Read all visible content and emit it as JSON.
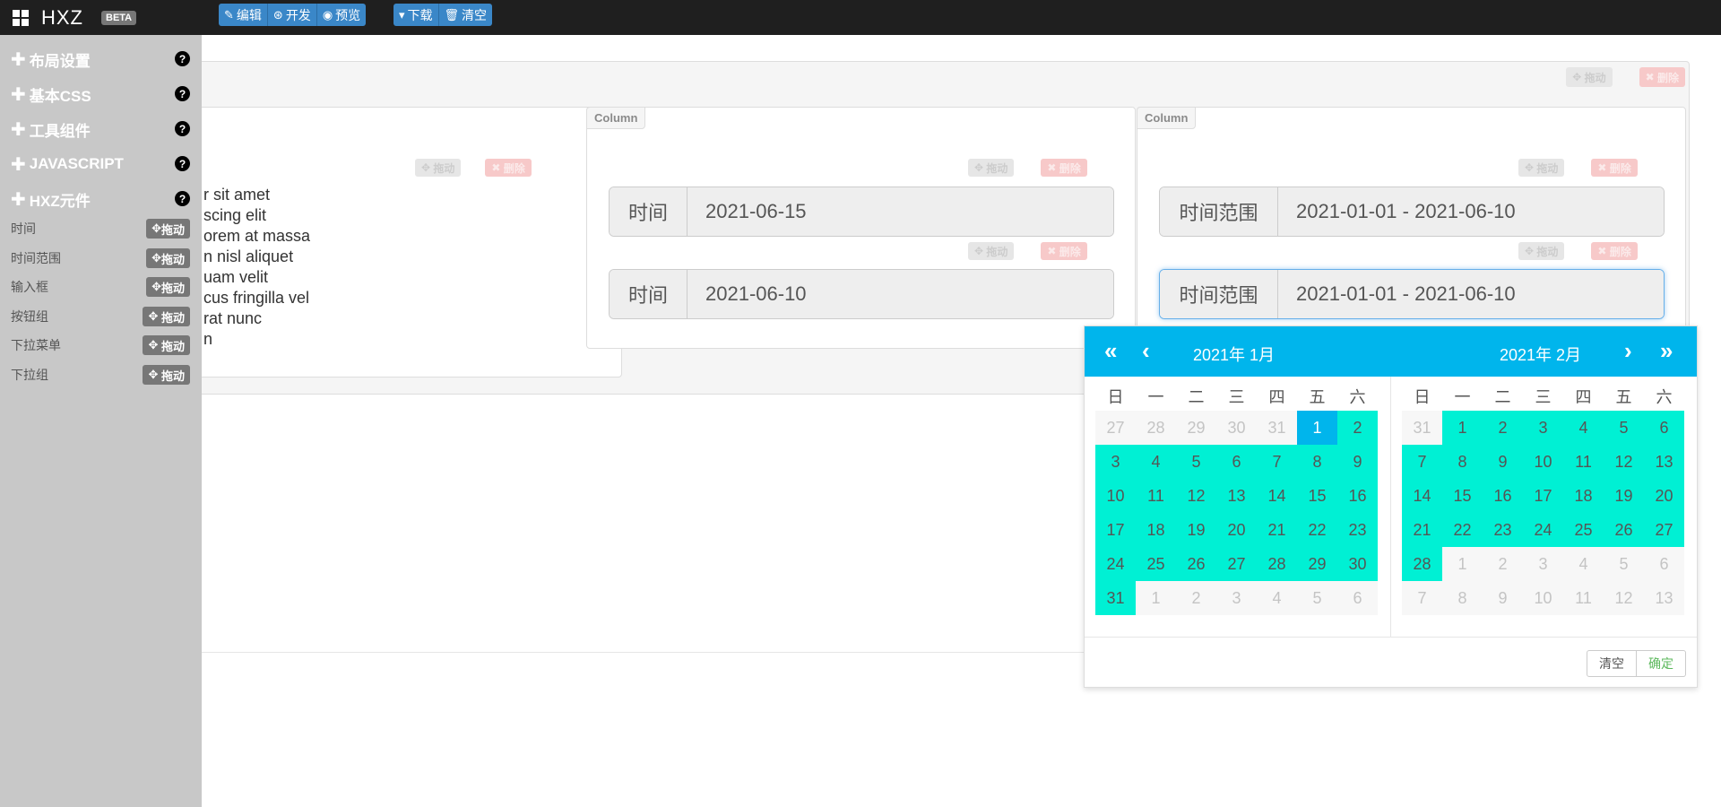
{
  "navbar": {
    "brand": "HXZ",
    "beta": "BETA",
    "group1": [
      {
        "label": "编辑",
        "icon": "edit-icon",
        "glyph": "✎"
      },
      {
        "label": "开发",
        "icon": "code-icon",
        "glyph": "⊛"
      },
      {
        "label": "预览",
        "icon": "eye-icon",
        "glyph": "◉"
      }
    ],
    "group2": [
      {
        "label": "下载",
        "icon": "chevron-down-icon",
        "glyph": "▾"
      },
      {
        "label": "清空",
        "icon": "trash-icon",
        "glyph": "🗑"
      }
    ]
  },
  "sidebar": {
    "sections": [
      "布局设置",
      "基本CSS",
      "工具组件",
      "JAVASCRIPT",
      "HXZ元件"
    ],
    "help_glyph": "?",
    "items": [
      "时间",
      "时间范围",
      "输入框",
      "按钮组",
      "下拉菜单",
      "下拉组"
    ],
    "drag_label": "拖动"
  },
  "layout": {
    "drag_label": "拖动",
    "delete_label": "删除",
    "column_label": "Column",
    "lorem_lines": [
      "r sit amet",
      "scing elit",
      "orem at massa",
      "n nisl aliquet",
      "uam velit",
      "cus fringilla vel",
      "rat nunc",
      "n"
    ],
    "date_inputs": [
      {
        "label": "时间",
        "value": "2021-06-15"
      },
      {
        "label": "时间",
        "value": "2021-06-10"
      }
    ],
    "range_inputs": [
      {
        "label": "时间范围",
        "value": "2021-01-01 - 2021-06-10"
      },
      {
        "label": "时间范围",
        "value": "2021-01-01 - 2021-06-10"
      }
    ]
  },
  "picker": {
    "left_title": "2021年  1月",
    "right_title": "2021年  2月",
    "weekdays": [
      "日",
      "一",
      "二",
      "三",
      "四",
      "五",
      "六"
    ],
    "left_days": [
      {
        "d": "27",
        "s": "out"
      },
      {
        "d": "28",
        "s": "out"
      },
      {
        "d": "29",
        "s": "out"
      },
      {
        "d": "30",
        "s": "out"
      },
      {
        "d": "31",
        "s": "out"
      },
      {
        "d": "1",
        "s": "start"
      },
      {
        "d": "2",
        "s": "range"
      },
      {
        "d": "3",
        "s": "range"
      },
      {
        "d": "4",
        "s": "range"
      },
      {
        "d": "5",
        "s": "range"
      },
      {
        "d": "6",
        "s": "range"
      },
      {
        "d": "7",
        "s": "range"
      },
      {
        "d": "8",
        "s": "range"
      },
      {
        "d": "9",
        "s": "range"
      },
      {
        "d": "10",
        "s": "range"
      },
      {
        "d": "11",
        "s": "range"
      },
      {
        "d": "12",
        "s": "range"
      },
      {
        "d": "13",
        "s": "range"
      },
      {
        "d": "14",
        "s": "range"
      },
      {
        "d": "15",
        "s": "range"
      },
      {
        "d": "16",
        "s": "range"
      },
      {
        "d": "17",
        "s": "range"
      },
      {
        "d": "18",
        "s": "range"
      },
      {
        "d": "19",
        "s": "range"
      },
      {
        "d": "20",
        "s": "range"
      },
      {
        "d": "21",
        "s": "range"
      },
      {
        "d": "22",
        "s": "range"
      },
      {
        "d": "23",
        "s": "range"
      },
      {
        "d": "24",
        "s": "range"
      },
      {
        "d": "25",
        "s": "range"
      },
      {
        "d": "26",
        "s": "range"
      },
      {
        "d": "27",
        "s": "range"
      },
      {
        "d": "28",
        "s": "range"
      },
      {
        "d": "29",
        "s": "range"
      },
      {
        "d": "30",
        "s": "range"
      },
      {
        "d": "31",
        "s": "range"
      },
      {
        "d": "1",
        "s": "out"
      },
      {
        "d": "2",
        "s": "out"
      },
      {
        "d": "3",
        "s": "out"
      },
      {
        "d": "4",
        "s": "out"
      },
      {
        "d": "5",
        "s": "out"
      },
      {
        "d": "6",
        "s": "out"
      }
    ],
    "right_days": [
      {
        "d": "31",
        "s": "out"
      },
      {
        "d": "1",
        "s": "range"
      },
      {
        "d": "2",
        "s": "range"
      },
      {
        "d": "3",
        "s": "range"
      },
      {
        "d": "4",
        "s": "range"
      },
      {
        "d": "5",
        "s": "range"
      },
      {
        "d": "6",
        "s": "range"
      },
      {
        "d": "7",
        "s": "range"
      },
      {
        "d": "8",
        "s": "range"
      },
      {
        "d": "9",
        "s": "range"
      },
      {
        "d": "10",
        "s": "range"
      },
      {
        "d": "11",
        "s": "range"
      },
      {
        "d": "12",
        "s": "range"
      },
      {
        "d": "13",
        "s": "range"
      },
      {
        "d": "14",
        "s": "range"
      },
      {
        "d": "15",
        "s": "range"
      },
      {
        "d": "16",
        "s": "range"
      },
      {
        "d": "17",
        "s": "range"
      },
      {
        "d": "18",
        "s": "range"
      },
      {
        "d": "19",
        "s": "range"
      },
      {
        "d": "20",
        "s": "range"
      },
      {
        "d": "21",
        "s": "range"
      },
      {
        "d": "22",
        "s": "range"
      },
      {
        "d": "23",
        "s": "range"
      },
      {
        "d": "24",
        "s": "range"
      },
      {
        "d": "25",
        "s": "range"
      },
      {
        "d": "26",
        "s": "range"
      },
      {
        "d": "27",
        "s": "range"
      },
      {
        "d": "28",
        "s": "range"
      },
      {
        "d": "1",
        "s": "out"
      },
      {
        "d": "2",
        "s": "out"
      },
      {
        "d": "3",
        "s": "out"
      },
      {
        "d": "4",
        "s": "out"
      },
      {
        "d": "5",
        "s": "out"
      },
      {
        "d": "6",
        "s": "out"
      },
      {
        "d": "7",
        "s": "out"
      },
      {
        "d": "8",
        "s": "out"
      },
      {
        "d": "9",
        "s": "out"
      },
      {
        "d": "10",
        "s": "out"
      },
      {
        "d": "11",
        "s": "out"
      },
      {
        "d": "12",
        "s": "out"
      },
      {
        "d": "13",
        "s": "out"
      }
    ],
    "clear_label": "清空",
    "ok_label": "确定",
    "colors": {
      "header": "#00b5ec",
      "range": "#00f0d4",
      "start": "#00b5ec"
    }
  }
}
